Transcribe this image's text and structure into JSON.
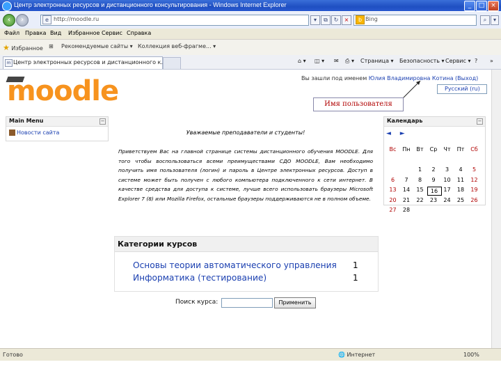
{
  "window": {
    "title": "Центр электронных ресурсов и дистанционного консультирования - Windows Internet Explorer",
    "min": "_",
    "max": "□",
    "close": "×"
  },
  "address": {
    "url": "http://moodle.ru",
    "search_text": "Bing"
  },
  "menubar": [
    "Файл",
    "Правка",
    "Вид",
    "Избранное",
    "Сервис",
    "Справка"
  ],
  "favorites": {
    "label": "Избранное",
    "items": [
      "Рекомендуемые сайты ▾",
      "Коллекция веб-фрагме... ▾"
    ]
  },
  "tab": {
    "title": "Центр электронных ресурсов и дистанционного к..."
  },
  "commands": [
    "Страница ▾",
    "Безопасность ▾",
    "Сервис ▾"
  ],
  "header": {
    "logo": "moodle",
    "login_prefix": "Вы зашли под именем",
    "login_user": "Юлия Владимировна Котина",
    "login_logout": "(Выход)",
    "language": "Русский (ru)",
    "callout": "Имя пользователя"
  },
  "main_menu": {
    "title": "Main Menu",
    "items": [
      "Новости сайта"
    ]
  },
  "welcome": {
    "heading": "Уважаемые преподаватели и студенты!",
    "text": "Приветствуем Вас на главной странице системы дистанционного обучения MOODLE. Для того чтобы воспользоваться всеми преимуществами СДО MOODLE, Вам необходимо получить имя пользователя (логин) и пароль в Центре электронных ресурсов. Доступ в системе может быть получен с любого компьютера подключенного к сети интернет. В качестве средства для доступа к системе, лучше всего использовать браузеры Microsoft Explorer 7 (8) или Mozilla Firefox, остальные браузеры поддерживаются не в полном объеме."
  },
  "categories": {
    "title": "Категории курсов",
    "items": [
      {
        "name": "Основы теории автоматического управления",
        "count": "1"
      },
      {
        "name": "Информатика (тестирование)",
        "count": "1"
      }
    ]
  },
  "course_search": {
    "label": "Поиск курса:",
    "button": "Применить"
  },
  "calendar": {
    "title": "Календарь",
    "prev": "◄",
    "next": "►",
    "weekdays": [
      "Вс",
      "Пн",
      "Вт",
      "Ср",
      "Чт",
      "Пт",
      "Сб"
    ],
    "weeks": [
      [
        "",
        "",
        "",
        "",
        "",
        "",
        ""
      ],
      [
        "",
        "",
        "1",
        "2",
        "3",
        "4",
        "5"
      ],
      [
        "6",
        "7",
        "8",
        "9",
        "10",
        "11",
        "12"
      ],
      [
        "13",
        "14",
        "15",
        "16",
        "17",
        "18",
        "19"
      ],
      [
        "20",
        "21",
        "22",
        "23",
        "24",
        "25",
        "26"
      ],
      [
        "27",
        "28",
        "",
        "",
        "",
        "",
        ""
      ]
    ],
    "today": "16"
  },
  "status": {
    "text": "Готово",
    "zone": "Интернет",
    "zoom": "100%"
  }
}
